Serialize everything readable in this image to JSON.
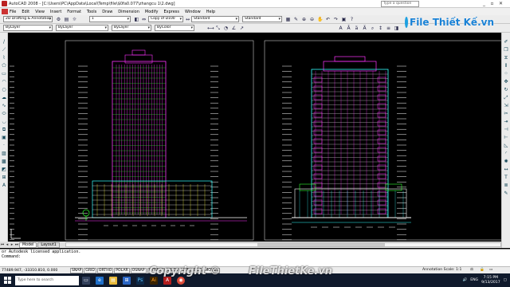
{
  "window": {
    "title": "AutoCAD 2008 - [C:\\Users\\PC\\AppData\\Local\\Temp\\file\\$0fa0.077\\zhangcu 1\\2.dwg]",
    "help_placeholder": "Type a question",
    "controls": [
      "_",
      "▫",
      "✕"
    ]
  },
  "menu": [
    "File",
    "Edit",
    "View",
    "Insert",
    "Format",
    "Tools",
    "Draw",
    "Dimension",
    "Modify",
    "Express",
    "Window",
    "Help"
  ],
  "toolbar1": {
    "workspace": "2D Drafting & Annotation",
    "layer_state": "1",
    "dimstyle": "Copy of D100",
    "textstyle": "Standard",
    "tablestyle": "Standard"
  },
  "toolbar2": {
    "layer": "ByLayer",
    "color": "ByLayer",
    "linetype": "ByLayer",
    "lineweight": "ByColor"
  },
  "layout_tabs": [
    "Model",
    "Layout1"
  ],
  "command_history": [
    "or Autodesk licensed application.",
    "Command:"
  ],
  "status": {
    "coordinates": "77489.947, -33310.810, 0.000",
    "toggles": [
      "SNAP",
      "GRID",
      "ORTHO",
      "POLAR",
      "OSNAP",
      "OTRACK",
      "DUCS",
      "DYN",
      "LWT",
      "MODEL"
    ],
    "annotation_label": "Annotation Scale:",
    "annotation_value": "1:1"
  },
  "taskbar": {
    "search_placeholder": "Type here to search",
    "language": "ENG",
    "time": "7:15 PM",
    "date": "9/13/2017"
  },
  "watermark": {
    "copyright": "Copyright © ",
    "brand_bottom": "FileThietKe.vn",
    "brand_top": "File Thiết Kế.vn"
  },
  "colors": {
    "canvas": "#000000",
    "magenta": "#ff33ff",
    "cyan": "#33ffff",
    "green": "#33ff33",
    "yellow": "#ffff33",
    "white": "#ffffff",
    "taskbar": "#101a2c"
  }
}
